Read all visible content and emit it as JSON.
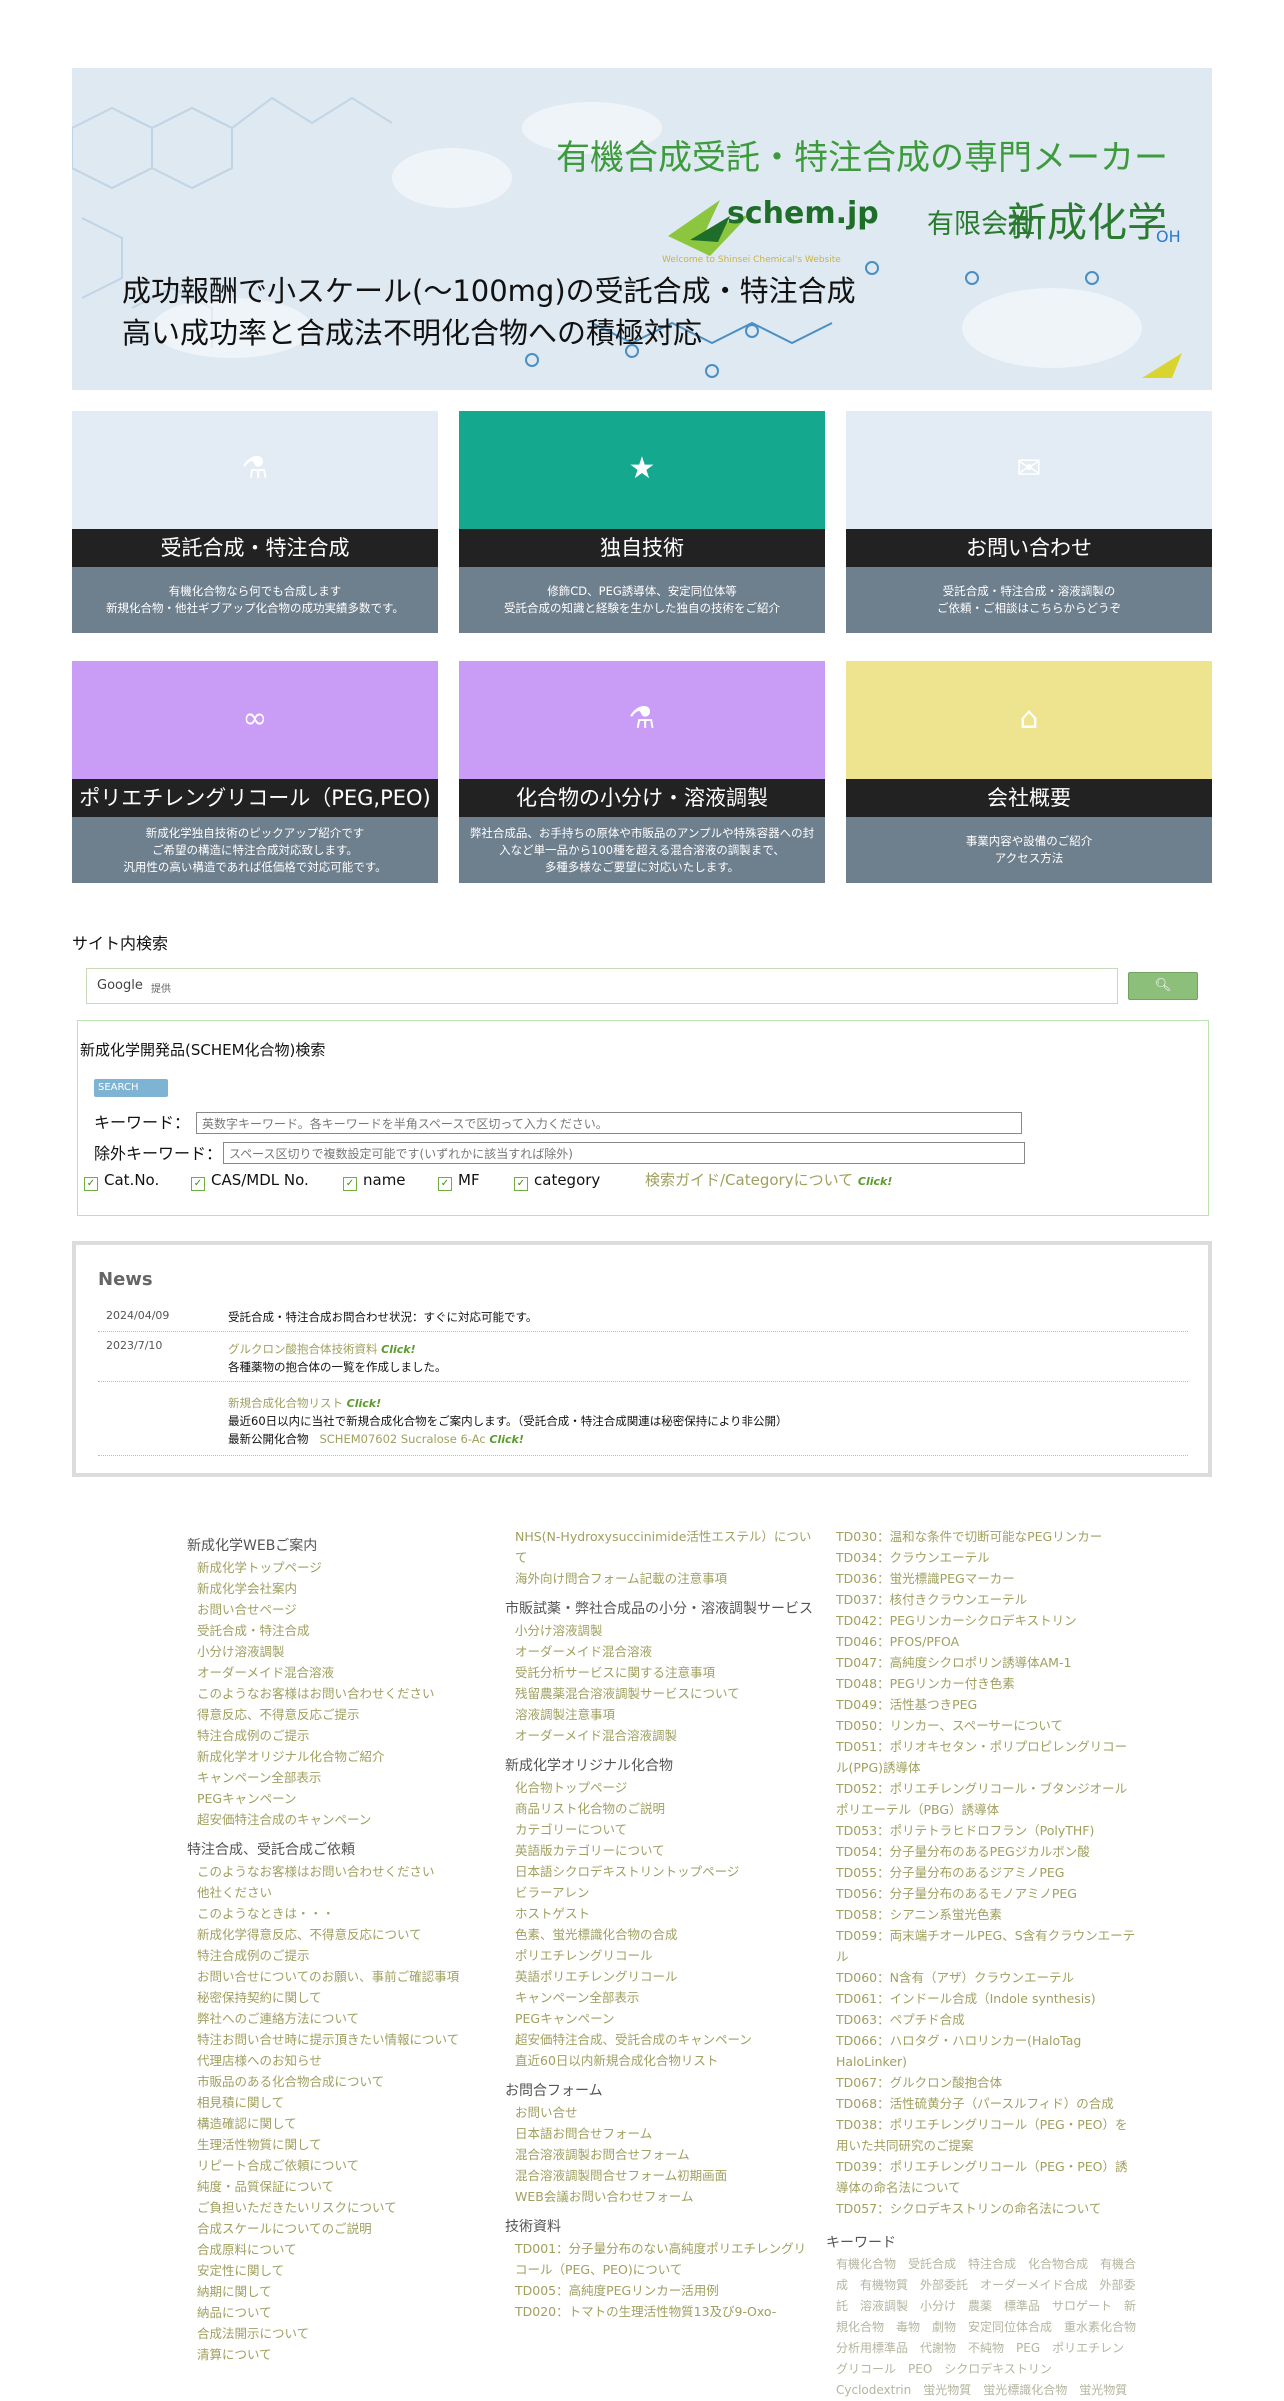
{
  "hero": {
    "tagline": "有機合成受託・特注合成の専門メーカー",
    "logo_text": "schem.jp",
    "logo_sub": "Welcome to Shinsei Chemical's Website",
    "company_type": "有限会社",
    "company_name": "新成化学",
    "line1": "成功報酬で小スケール(〜100mg)の受託合成・特注合成",
    "line2": "高い成功率と合成法不明化合物への積極対応"
  },
  "tiles": [
    {
      "title": "受託合成・特注合成",
      "desc": [
        "有機化合物なら何でも合成します",
        "新規化合物・他社ギブアップ化合物の成功実績多数です。"
      ],
      "style": "pat",
      "icon": "flask-icon"
    },
    {
      "title": "独自技術",
      "desc": [
        "修飾CD、PEG誘導体、安定同位体等",
        "受託合成の知識と経験を生かした独自の技術をご紹介"
      ],
      "style": "teal",
      "icon": "lightbulb-icon"
    },
    {
      "title": "お問い合わせ",
      "desc": [
        "受託合成・特注合成・溶液調製の",
        "ご依頼・ご相談はこちらからどうぞ"
      ],
      "style": "pat",
      "icon": "mail-icon"
    },
    {
      "title": "ポリエチレングリコール（PEG,PEO)",
      "desc": [
        "新成化学独自技術のピックアップ紹介です",
        "ご希望の構造に特注合成対応致します。",
        "汎用性の高い構造であれば低価格で対応可能です。"
      ],
      "style": "lav",
      "icon": "chain-icon"
    },
    {
      "title": "化合物の小分け・溶液調製",
      "desc": [
        "弊社合成品、お手持ちの原体や市販品のアンプルや特殊容器への封",
        "入など単一品から100種を超える混合溶液の調製まで、",
        "多種多様なご要望に対応いたします。"
      ],
      "style": "lav",
      "icon": "vial-icon"
    },
    {
      "title": "会社概要",
      "desc": [
        "事業内容や設備のご紹介",
        "アクセス方法"
      ],
      "style": "yel",
      "icon": "building-icon"
    }
  ],
  "site_search": {
    "title": "サイト内検索",
    "google_label": "Google",
    "powered": "提供",
    "button_icon": "search-icon"
  },
  "schem_search": {
    "title": "新成化学開発品(SCHEM化合物)検索",
    "badge": "SEARCH",
    "keyword_label": "キーワード：",
    "keyword_placeholder": "英数字キーワード。各キーワードを半角スペースで区切って入力ください。",
    "exclude_label": "除外キーワード：",
    "exclude_placeholder": "スペース区切りで複数設定可能です(いずれかに該当すれば除外)",
    "checks": [
      "Cat.No.",
      "CAS/MDL No.",
      "name",
      "MF",
      "category"
    ],
    "guide": "検索ガイド/Categoryについて",
    "click": "Click!"
  },
  "news": {
    "title": "News",
    "items": [
      {
        "date": "2024/04/09",
        "text": "受託合成・特注合成お問合わせ状況：すぐに対応可能です。"
      },
      {
        "date": "2023/7/10",
        "link": "グルクロン酸抱合体技術資料",
        "click": "Click!",
        "text": "各種薬物の抱合体の一覧を作成しました。"
      },
      {
        "date": "",
        "link": "新規合成化合物リスト",
        "click": "Click!",
        "text": "最近60日以内に当社で新規合成化合物をご案内します。（受託合成・特注合成関連は秘密保持により非公開）",
        "sub_label": "最新公開化合物",
        "sub_link": "SCHEM07602 Sucralose 6-Ac",
        "sub_click": "Click!"
      }
    ]
  },
  "footer": {
    "col1": [
      {
        "h": "新成化学WEBご案内",
        "items": [
          "新成化学トップページ",
          "新成化学会社案内",
          "お問い合せページ",
          "受託合成・特注合成",
          "小分け溶液調製",
          "オーダーメイド混合溶液",
          "このようなお客様はお問い合わせください",
          "得意反応、不得意反応ご提示",
          "特注合成例のご提示",
          "新成化学オリジナル化合物ご紹介",
          "キャンペーン全部表示",
          "PEGキャンペーン",
          "超安価特注合成のキャンペーン"
        ]
      },
      {
        "h": "特注合成、受託合成ご依頼",
        "items": [
          "このようなお客様はお問い合わせください",
          "他社ください",
          "このようなときは・・・",
          "新成化学得意反応、不得意反応について",
          "特注合成例のご提示",
          "お問い合せについてのお願い、事前ご確認事項",
          "秘密保持契約に関して",
          "弊社へのご連絡方法について",
          "特注お問い合せ時に提示頂きたい情報について",
          "代理店様へのお知らせ",
          "市販品のある化合物合成について",
          "相見積に関して",
          "構造確認に関して",
          "生理活性物質に関して",
          "リピート合成ご依頼について",
          "純度・品質保証について",
          "ご負担いただきたいリスクについて",
          "合成スケールについてのご説明",
          "合成原料について",
          "安定性に関して",
          "納期に関して",
          "納品について",
          "合成法開示について",
          "清算について"
        ]
      }
    ],
    "col2": [
      {
        "h": "",
        "items": [
          "NHS(N-Hydroxysuccinimide活性エステル）について",
          "海外向け問合フォーム記載の注意事項"
        ]
      },
      {
        "h": "市販試薬・弊社合成品の小分・溶液調製サービス",
        "items": [
          "小分け溶液調製",
          "オーダーメイド混合溶液",
          "受託分析サービスに関する注意事項",
          "残留農薬混合溶液調製サービスについて",
          "溶液調製注意事項",
          "オーダーメイド混合溶液調製"
        ]
      },
      {
        "h": "新成化学オリジナル化合物",
        "items": [
          "化合物トップページ",
          "商品リスト化合物のご説明",
          "カテゴリーについて",
          "英語版カテゴリーについて",
          "日本語シクロデキストリントップページ",
          "ビラーアレン",
          "ホストゲスト",
          "色素、蛍光標識化合物の合成",
          "ポリエチレングリコール",
          "英語ポリエチレングリコール",
          "キャンペーン全部表示",
          "PEGキャンペーン",
          "超安価特注合成、受託合成のキャンペーン",
          "直近60日以内新規合成化合物リスト"
        ]
      },
      {
        "h": "お問合フォーム",
        "items": [
          "お問い合せ",
          "日本語お問合せフォーム",
          "混合溶液調製お問合せフォーム",
          "混合溶液調製問合せフォーム初期画面",
          "WEB会議お問い合わせフォーム"
        ]
      },
      {
        "h": "技術資料",
        "items": [
          "TD001：分子量分布のない高純度ポリエチレングリコール（PEG、PEO)について",
          "TD005：高純度PEGリンカー活用例",
          "TD020：トマトの生理活性物質13及び9-Oxo-"
        ]
      }
    ],
    "col3": [
      {
        "h": "",
        "items": [
          "TD030：温和な条件で切断可能なPEGリンカー",
          "TD034：クラウンエーテル",
          "TD036：蛍光標識PEGマーカー",
          "TD037：核付きクラウンエーテル",
          "TD042：PEGリンカーシクロデキストリン",
          "TD046：PFOS/PFOA",
          "TD047：高純度シクロポリン誘導体AM-1",
          "TD048：PEGリンカー付き色素",
          "TD049：活性基つきPEG",
          "TD050：リンカー、スペーサーについて",
          "TD051：ポリオキセタン・ポリプロピレングリコール(PPG)誘導体",
          "TD052：ポリエチレングリコール・ブタンジオールポリエーテル（PBG）誘導体",
          "TD053：ポリテトラヒドロフラン（PolyTHF)",
          "TD054：分子量分布のあるPEGジカルボン酸",
          "TD055：分子量分布のあるジアミノPEG",
          "TD056：分子量分布のあるモノアミノPEG",
          "TD058：シアニン系蛍光色素",
          "TD059：両末端チオールPEG、S含有クラウンエーテル",
          "TD060：N含有（アザ）クラウンエーテル",
          "TD061：インドール合成（Indole synthesis)",
          "TD063：ペプチド合成",
          "TD066：ハロタグ・ハロリンカー(HaloTag HaloLinker)",
          "TD067：グルクロン酸抱合体",
          "TD068：活性硫黄分子（パースルフィド）の合成",
          "TD038：ポリエチレングリコール（PEG・PEO）を用いた共同研究のご提案",
          "TD039：ポリエチレングリコール（PEG・PEO）誘導体の命名法について",
          "TD057：シクロデキストリンの命名法について"
        ]
      }
    ],
    "keywords_title": "キーワード",
    "keywords": "有機化合物　受託合成　特注合成　化合物合成　有機合成　有機物質　外部委託　オーダーメイド合成　外部委託　溶液調製　小分け　農薬　標準品　サロゲート　新規化合物　毒物　劇物　安定同位体合成　重水素化合物　分析用標準品　代謝物　不純物　PEG　ポリエチレングリコール　PEO　シクロデキストリン　Cyclodextrin　蛍光物質　蛍光標識化合物　蛍光物質"
  }
}
